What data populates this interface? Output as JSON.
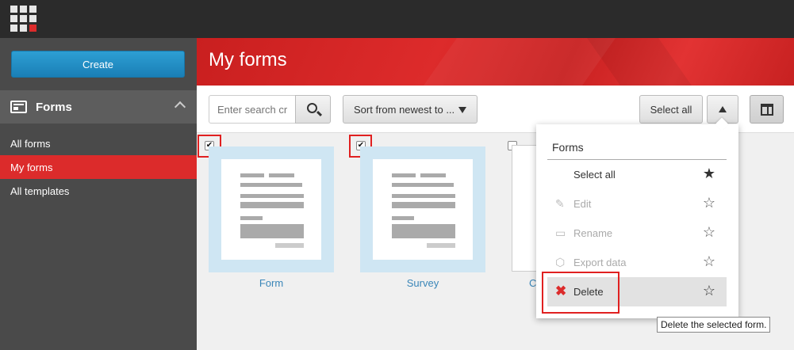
{
  "sidebar": {
    "create_label": "Create",
    "section_label": "Forms",
    "items": [
      {
        "label": "All forms"
      },
      {
        "label": "My forms"
      },
      {
        "label": "All templates"
      }
    ]
  },
  "header": {
    "title": "My forms"
  },
  "toolbar": {
    "search_placeholder": "Enter search criteria",
    "sort_label": "Sort from newest to ...",
    "select_all_label": "Select all"
  },
  "cards": [
    {
      "label": "Form",
      "checked": true
    },
    {
      "label": "Survey",
      "checked": true
    },
    {
      "label": "C",
      "checked": false
    }
  ],
  "dropdown": {
    "title": "Forms",
    "items": [
      {
        "label": "Select all",
        "enabled": true,
        "starred": true
      },
      {
        "label": "Edit",
        "enabled": false,
        "starred": false
      },
      {
        "label": "Rename",
        "enabled": false,
        "starred": false
      },
      {
        "label": "Export data",
        "enabled": false,
        "starred": false
      },
      {
        "label": "Delete",
        "enabled": true,
        "starred": false
      }
    ]
  },
  "tooltip": "Delete the selected form.",
  "colors": {
    "accent": "#dc2b2b",
    "brand_blue": "#1a7fb6",
    "sidebar": "#4a4a4a"
  }
}
